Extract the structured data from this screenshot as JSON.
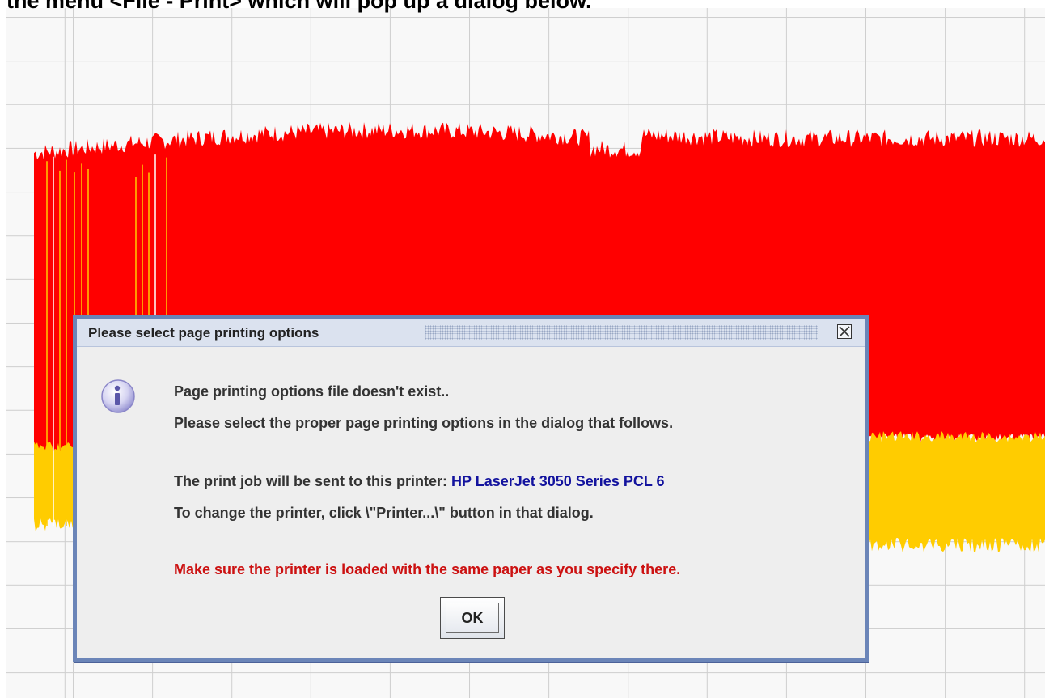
{
  "caption": "the menu <File - Print> which will pop up a dialog below.",
  "plot": {
    "upper_color": "#ff0000",
    "lower_color": "#ffcc00",
    "grid_color": "#cfcfcf"
  },
  "dialog": {
    "title": "Please select page printing options",
    "close_icon": "close-icon",
    "info_icon": "information-icon",
    "line1": "Page printing options file doesn't exist..",
    "line2": "Please select the proper page printing options in the dialog that follows.",
    "line3_prefix": "The print job will be sent to this printer: ",
    "printer_name": "HP LaserJet 3050 Series PCL 6",
    "line4": "To change the printer, click \\\"Printer...\\\" button in that dialog.",
    "warning": "Make sure the printer is loaded with the same paper as you specify there.",
    "ok_label": "OK"
  },
  "colors": {
    "dialog_border": "#6b85b8",
    "dialog_bg": "#eeeeee",
    "printer_name": "#13139e",
    "warning": "#cc1111"
  }
}
